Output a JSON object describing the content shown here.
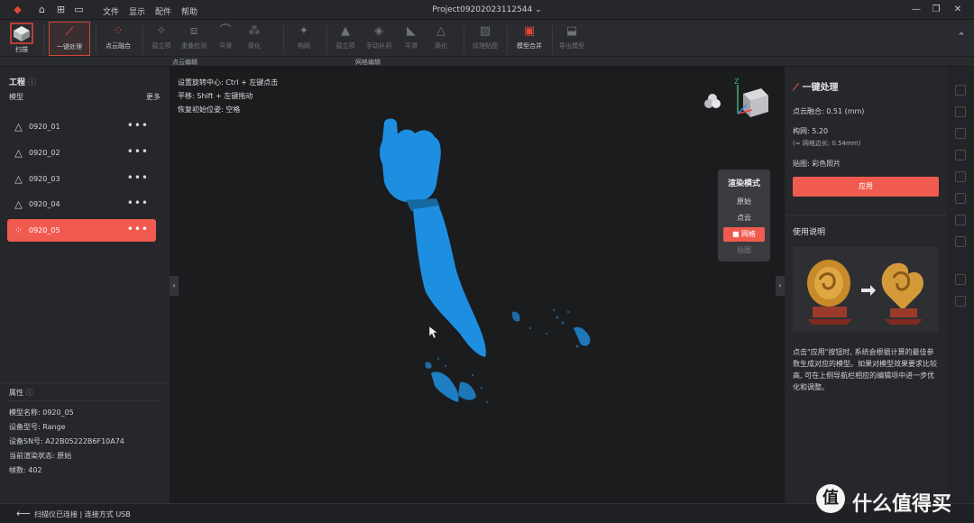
{
  "titlebar": {
    "menus": [
      "文件",
      "显示",
      "配件",
      "帮助"
    ],
    "project": "Project09202023112544"
  },
  "toolbar": {
    "scan": "扫描",
    "one_click": "一键处理",
    "point_fuse": "点云融合",
    "outlier": "孤立项",
    "overlap": "重叠检测",
    "smooth": "平滑",
    "simplify": "简化",
    "mesh": "构网",
    "mesh_outlier": "孤立项",
    "manual_fill": "手动补洞",
    "mesh_smooth": "平滑",
    "mesh_simplify": "简化",
    "texture": "纹理贴图",
    "merge": "模型合并",
    "export": "导出模型",
    "sec_point": "点云编辑",
    "sec_mesh": "网格编辑"
  },
  "left": {
    "project_title": "工程",
    "model_label": "模型",
    "more": "更多",
    "models": [
      "0920_01",
      "0920_02",
      "0920_03",
      "0920_04",
      "0920_05"
    ],
    "props_title": "属性",
    "props": [
      "模型名称: 0920_05",
      "设备型号: Range",
      "设备SN号: A22B05222B6F10A74",
      "当前渲染状态: 原始",
      "帧数: 402"
    ]
  },
  "viewport": {
    "hints": [
      "设置旋转中心: Ctrl + 左键点击",
      "平移: Shift + 左键拖动",
      "恢复初始位姿: 空格"
    ],
    "render_title": "渲染模式",
    "render_options": [
      "原始",
      "点云",
      "网格",
      "贴图"
    ],
    "render_selected": "网格",
    "axis_z": "Z"
  },
  "right": {
    "title": "一键处理",
    "fuse": "点云融合:  0.51 (mm)",
    "mesh": "构网:  5.20",
    "mesh_sub": "(≈ 网格边长: 0.54mm)",
    "texture": "贴图: 彩色照片",
    "apply": "应用",
    "usage_title": "使用说明",
    "usage_text": [
      "点击\"应用\"按钮时, 系统会根据计算的最佳参",
      "数生成对应的模型。如果对模型效果要求比较",
      "高, 可在上侧导航栏相应的编辑项中进一步优",
      "化和调整。"
    ]
  },
  "status": {
    "text": "扫描仪已连接 | 连接方式 USB"
  },
  "watermark": {
    "glyph": "值",
    "text": "什么值得买"
  },
  "colors": {
    "accent": "#f05a4f",
    "model": "#1e8fe0",
    "panel": "#26272a"
  }
}
